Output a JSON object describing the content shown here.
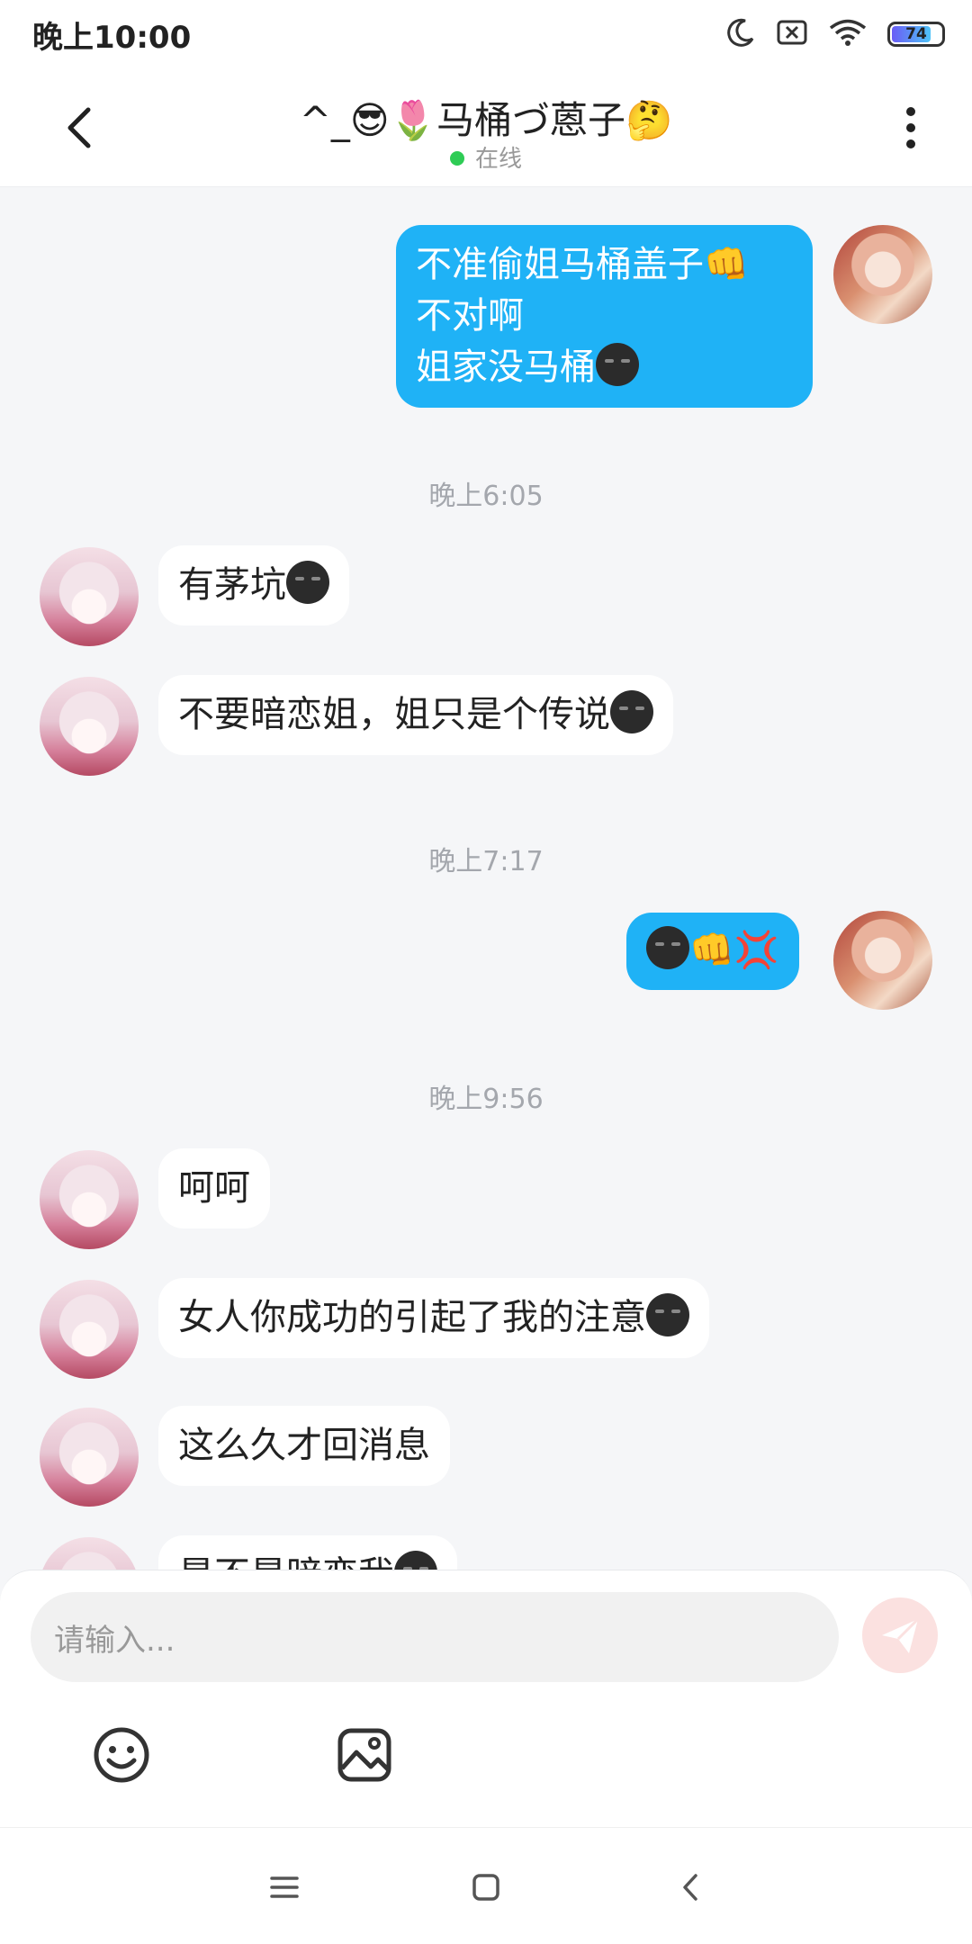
{
  "status_bar": {
    "time": "晚上10:00",
    "battery_level": "74",
    "icons": [
      "moon-icon",
      "sim-off-icon",
      "wifi-icon",
      "battery-icon"
    ]
  },
  "header": {
    "title": "^_😎🌷马桶づ蒽子🤔",
    "status_text": "在线",
    "status_color": "#2ecc55"
  },
  "messages": [
    {
      "from": "self",
      "lines": [
        "不准偷姐马桶盖子👊",
        "不对啊",
        "姐家没马桶"
      ]
    },
    {
      "time": "晚上6:05"
    },
    {
      "from": "other",
      "text": "有茅坑"
    },
    {
      "from": "other",
      "text": "不要暗恋姐，姐只是个传说"
    },
    {
      "time": "晚上7:17"
    },
    {
      "from": "self",
      "text": "👊💢"
    },
    {
      "time": "晚上9:56"
    },
    {
      "from": "other",
      "text": "呵呵"
    },
    {
      "from": "other",
      "text": "女人你成功的引起了我的注意"
    },
    {
      "from": "other",
      "text": "这么久才回消息"
    },
    {
      "from": "other",
      "text": "是不是暗恋我"
    }
  ],
  "input": {
    "placeholder": "请输入..."
  },
  "colors": {
    "self_bubble": "#1fb2f6",
    "other_bubble": "#ffffff",
    "background": "#f5f6f8",
    "send_button": "#fbe1e0"
  }
}
